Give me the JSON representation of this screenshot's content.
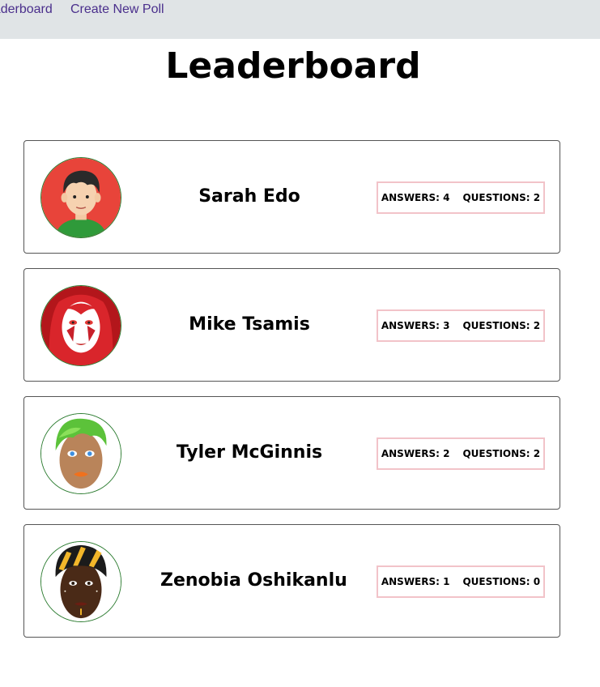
{
  "nav": {
    "links": [
      {
        "label": "Leaderboard"
      },
      {
        "label": "Create New Poll"
      }
    ]
  },
  "page": {
    "title": "Leaderboard"
  },
  "leaderboard": [
    {
      "name": "Sarah Edo",
      "answers_label": "ANSWERS:",
      "answers": "4",
      "questions_label": "QUESTIONS:",
      "questions": "2",
      "avatar": "young-man-avatar-icon"
    },
    {
      "name": "Mike Tsamis",
      "answers_label": "ANSWERS:",
      "answers": "3",
      "questions_label": "QUESTIONS:",
      "questions": "2",
      "avatar": "red-face-paint-woman-avatar-icon"
    },
    {
      "name": "Tyler McGinnis",
      "answers_label": "ANSWERS:",
      "answers": "2",
      "questions_label": "QUESTIONS:",
      "questions": "2",
      "avatar": "green-hair-woman-avatar-icon"
    },
    {
      "name": "Zenobia Oshikanlu",
      "answers_label": "ANSWERS:",
      "answers": "1",
      "questions_label": "QUESTIONS:",
      "questions": "0",
      "avatar": "headwrap-woman-avatar-icon"
    }
  ],
  "colors": {
    "nav_bg": "#e0e4e6",
    "nav_link": "#4a2f8c",
    "stats_border": "#f2c3c9",
    "avatar_border": "#2e7d32"
  }
}
